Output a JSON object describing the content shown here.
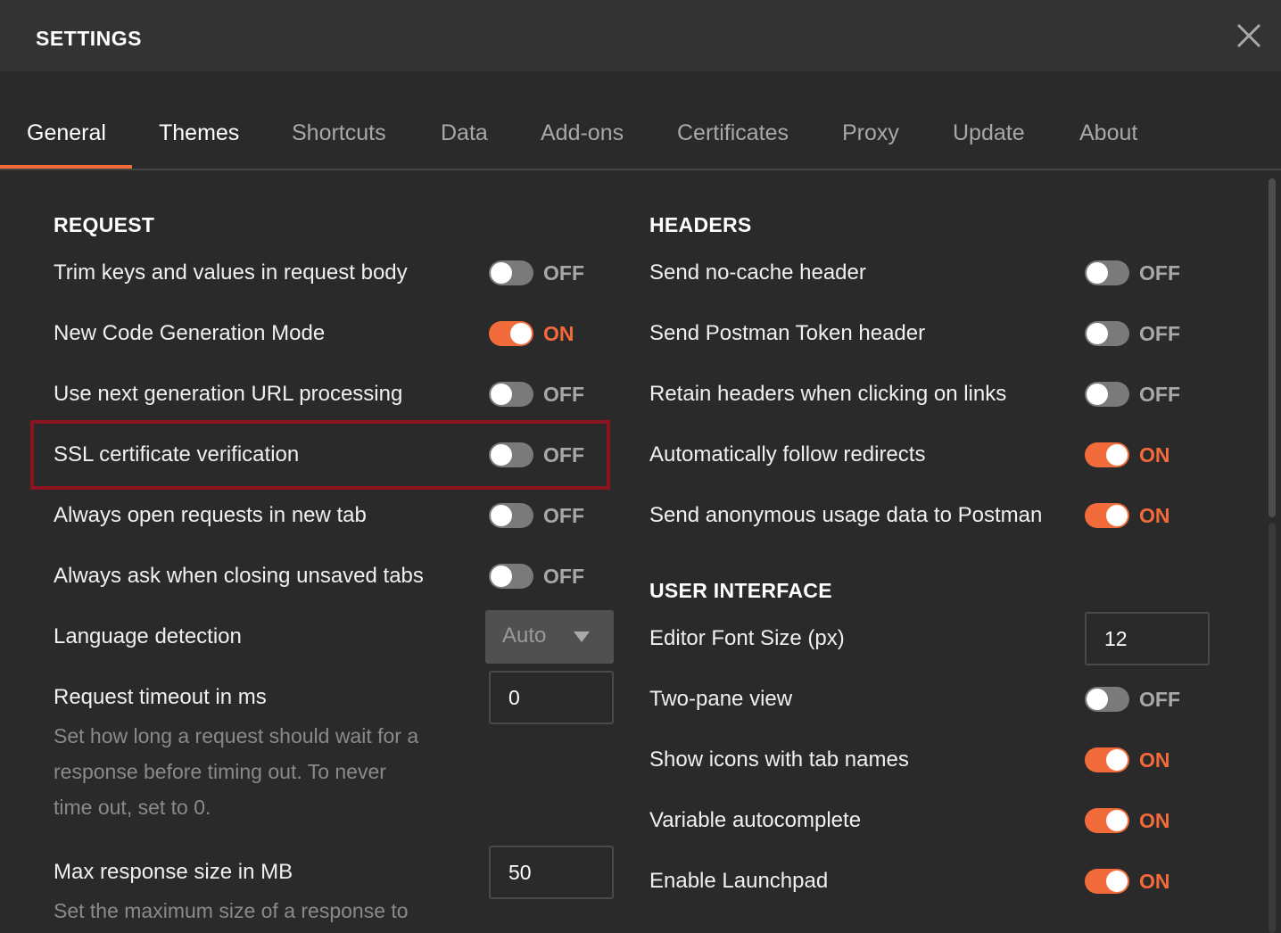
{
  "window": {
    "title": "SETTINGS"
  },
  "tabs": [
    "General",
    "Themes",
    "Shortcuts",
    "Data",
    "Add-ons",
    "Certificates",
    "Proxy",
    "Update",
    "About"
  ],
  "request": {
    "heading": "REQUEST",
    "trim": {
      "label": "Trim keys and values in request body",
      "state": "OFF"
    },
    "codegen": {
      "label": "New Code Generation Mode",
      "state": "ON"
    },
    "urlproc": {
      "label": "Use next generation URL processing",
      "state": "OFF"
    },
    "ssl": {
      "label": "SSL certificate verification",
      "state": "OFF"
    },
    "newtab": {
      "label": "Always open requests in new tab",
      "state": "OFF"
    },
    "askclose": {
      "label": "Always ask when closing unsaved tabs",
      "state": "OFF"
    },
    "lang": {
      "label": "Language detection",
      "value": "Auto"
    },
    "timeout": {
      "label": "Request timeout in ms",
      "value": "0",
      "desc_lines": [
        "Set how long a request should wait for a",
        "response before timing out. To never",
        "time out, set to 0."
      ]
    },
    "maxsize": {
      "label": "Max response size in MB",
      "value": "50",
      "desc_lines": [
        "Set the maximum size of a response to"
      ]
    }
  },
  "headers": {
    "heading": "HEADERS",
    "nocache": {
      "label": "Send no-cache header",
      "state": "OFF"
    },
    "token": {
      "label": "Send Postman Token header",
      "state": "OFF"
    },
    "retain": {
      "label": "Retain headers when clicking on links",
      "state": "OFF"
    },
    "redirects": {
      "label": "Automatically follow redirects",
      "state": "ON"
    },
    "usage": {
      "label": "Send anonymous usage data to Postman",
      "state": "ON"
    }
  },
  "ui": {
    "heading": "USER INTERFACE",
    "fontsize": {
      "label": "Editor Font Size (px)",
      "value": "12"
    },
    "twopane": {
      "label": "Two-pane view",
      "state": "OFF"
    },
    "tabicons": {
      "label": "Show icons with tab names",
      "state": "ON"
    },
    "autocomplete": {
      "label": "Variable autocomplete",
      "state": "ON"
    },
    "launchpad": {
      "label": "Enable Launchpad",
      "state": "ON"
    }
  },
  "colors": {
    "accent": "#f26b3a",
    "highlight_border": "#8a1420",
    "background": "#2a2a2a"
  },
  "icons": {
    "close": "close-icon",
    "dropdown": "chevron-down-icon"
  }
}
